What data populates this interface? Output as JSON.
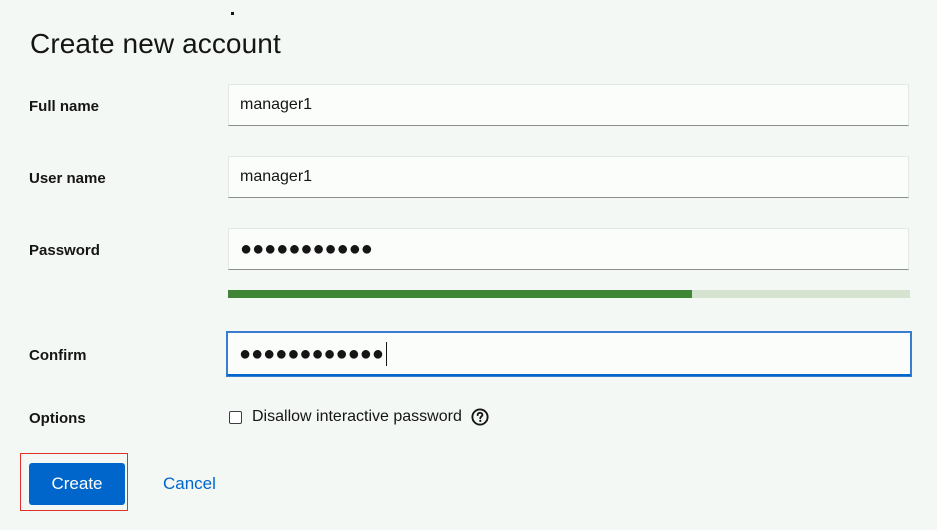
{
  "dialog": {
    "title": "Create new account"
  },
  "form": {
    "full_name": {
      "label": "Full name",
      "value": "manager1"
    },
    "user_name": {
      "label": "User name",
      "value": "manager1"
    },
    "password": {
      "label": "Password",
      "masked_value": "●●●●●●●●●●●",
      "strength_fraction": 0.68,
      "strength_color": "#3e8635"
    },
    "confirm": {
      "label": "Confirm",
      "masked_value": "●●●●●●●●●●●●"
    },
    "options": {
      "label": "Options",
      "disallow_interactive_label": "Disallow interactive password",
      "disallow_interactive_checked": false,
      "help_icon": "question-circle-icon"
    }
  },
  "actions": {
    "create_label": "Create",
    "cancel_label": "Cancel"
  },
  "colors": {
    "accent": "#0066cc",
    "highlight": "#e0302a"
  }
}
